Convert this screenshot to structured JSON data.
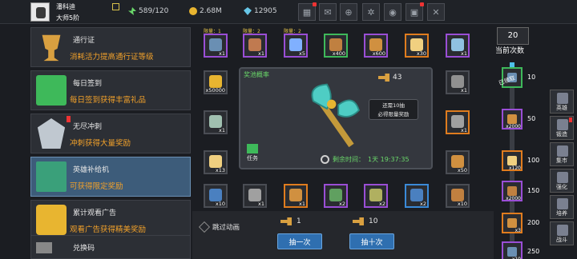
{
  "player": {
    "name": "潘科迪",
    "level": "大师5阶"
  },
  "resources": {
    "energy": "589/120",
    "gold": "2.68M",
    "gems": "12905"
  },
  "top_buttons": [
    "shop-icon",
    "mail-icon",
    "gamepad-icon",
    "settings-icon",
    "swirl-icon",
    "gift-icon",
    "close-icon"
  ],
  "left_menu": [
    {
      "title": "通行证",
      "desc": "消耗活力提高通行证等级",
      "icon_color": "#d9a040",
      "badge": false,
      "active": false
    },
    {
      "title": "每日签到",
      "desc": "每日签到获得丰富礼品",
      "icon_color": "#3eb95a",
      "badge": false,
      "active": false
    },
    {
      "title": "无尽冲刺",
      "desc": "冲刺获得大量奖励",
      "icon_color": "#c0c8d0",
      "badge": true,
      "active": false
    },
    {
      "title": "英雄补给机",
      "desc": "可获得限定奖励",
      "icon_color": "#3aa07a",
      "badge": false,
      "active": true
    },
    {
      "title": "累计观看广告",
      "desc": "观看广告获得精美奖励",
      "icon_color": "#e8b530",
      "badge": false,
      "active": false
    },
    {
      "title": "兑换码",
      "desc": "",
      "icon_color": "#888888",
      "badge": false,
      "active": false
    }
  ],
  "limit_tag": "限量：1",
  "limit_tag2": "限量：2",
  "top_row": [
    {
      "count": "x1",
      "rarity": "purple",
      "color": "#6a8fb3",
      "limited": "限量：1"
    },
    {
      "count": "x1",
      "rarity": "purple",
      "color": "#c07a50",
      "limited": "限量：2"
    },
    {
      "count": "x5",
      "rarity": "purple",
      "color": "#80b0ff",
      "limited": "限量：2"
    },
    {
      "count": "x400",
      "rarity": "green",
      "color": "#c08040",
      "limited": ""
    },
    {
      "count": "x600",
      "rarity": "purple",
      "color": "#d09040",
      "limited": ""
    },
    {
      "count": "x30",
      "rarity": "orange",
      "color": "#f0d080",
      "limited": ""
    },
    {
      "count": "x1",
      "rarity": "purple",
      "color": "#90c0e0",
      "limited": ""
    }
  ],
  "left_col": [
    {
      "count": "x50000",
      "rarity": "",
      "color": "#e8b530"
    },
    {
      "count": "x1",
      "rarity": "",
      "color": "#a0c0b0"
    },
    {
      "count": "x13",
      "rarity": "",
      "color": "#f0d080"
    }
  ],
  "right_col": [
    {
      "count": "x1",
      "rarity": "",
      "color": "#909090"
    },
    {
      "count": "x1",
      "rarity": "orange",
      "color": "#a0a0a0"
    },
    {
      "count": "x50",
      "rarity": "",
      "color": "#d09040"
    }
  ],
  "bottom_row": [
    {
      "count": "x10",
      "rarity": "",
      "color": "#4a80c0"
    },
    {
      "count": "x1",
      "rarity": "",
      "color": "#a0a0a0"
    },
    {
      "count": "x1",
      "rarity": "orange",
      "color": "#d09040"
    },
    {
      "count": "x2",
      "rarity": "purple",
      "color": "#60a060"
    },
    {
      "count": "x2",
      "rarity": "purple",
      "color": "#b0b060"
    },
    {
      "count": "x2",
      "rarity": "blue",
      "color": "#4a80c0"
    },
    {
      "count": "x10",
      "rarity": "",
      "color": "#c08040"
    }
  ],
  "center": {
    "title": "奖池概率",
    "key_count": "43",
    "tip_line1": "还需10抽",
    "tip_line2": "必得限量奖励",
    "timer_label": "剩余时间：",
    "timer_value": "1天 19:37:35",
    "task_label": "任务"
  },
  "bottom": {
    "skip_label": "跳过动画",
    "cost1": "1",
    "cost10": "10",
    "draw1": "抽一次",
    "draw10": "抽十次"
  },
  "progress": {
    "current": "20",
    "label": "当前次数",
    "side_label": "已领取",
    "fill_fraction": 0.08,
    "milestones": [
      {
        "value": "10",
        "count": "",
        "rarity": "green",
        "color": "#6a8fb3"
      },
      {
        "value": "50",
        "count": "x2000",
        "rarity": "purple",
        "color": "#d09040"
      },
      {
        "value": "100",
        "count": "x120",
        "rarity": "orange",
        "color": "#f0d080"
      },
      {
        "value": "150",
        "count": "x2000",
        "rarity": "purple",
        "color": "#c08040"
      },
      {
        "value": "200",
        "count": "x3",
        "rarity": "orange",
        "color": "#d09040"
      },
      {
        "value": "250",
        "count": "x10",
        "rarity": "purple",
        "color": "#6a8fb3"
      }
    ]
  },
  "right_nav": [
    {
      "label": "英雄",
      "dot": false
    },
    {
      "label": "锻造",
      "dot": true
    },
    {
      "label": "集市",
      "dot": false
    },
    {
      "label": "强化",
      "dot": false
    },
    {
      "label": "培养",
      "dot": false
    },
    {
      "label": "战斗",
      "dot": false
    }
  ]
}
